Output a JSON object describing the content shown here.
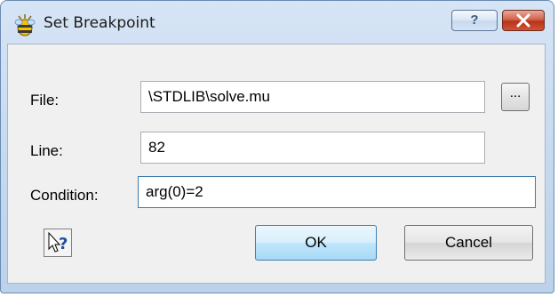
{
  "window": {
    "title": "Set Breakpoint",
    "help_button": "?",
    "close_button": "close"
  },
  "form": {
    "file_label": "File:",
    "file_value": "\\STDLIB\\solve.mu",
    "browse_label": "...",
    "line_label": "Line:",
    "line_value": "82",
    "condition_label": "Condition:",
    "condition_value": "arg(0)=2"
  },
  "buttons": {
    "ok": "OK",
    "cancel": "Cancel"
  },
  "icons": {
    "title": "breakpoint-bug-icon",
    "context_help": "context-help-icon",
    "close": "close-x-icon"
  },
  "colors": {
    "window_frame": "#c4d8ee",
    "close_button": "#c8432a",
    "default_button": "#bee6fd",
    "focus_border": "#3d7bad"
  }
}
